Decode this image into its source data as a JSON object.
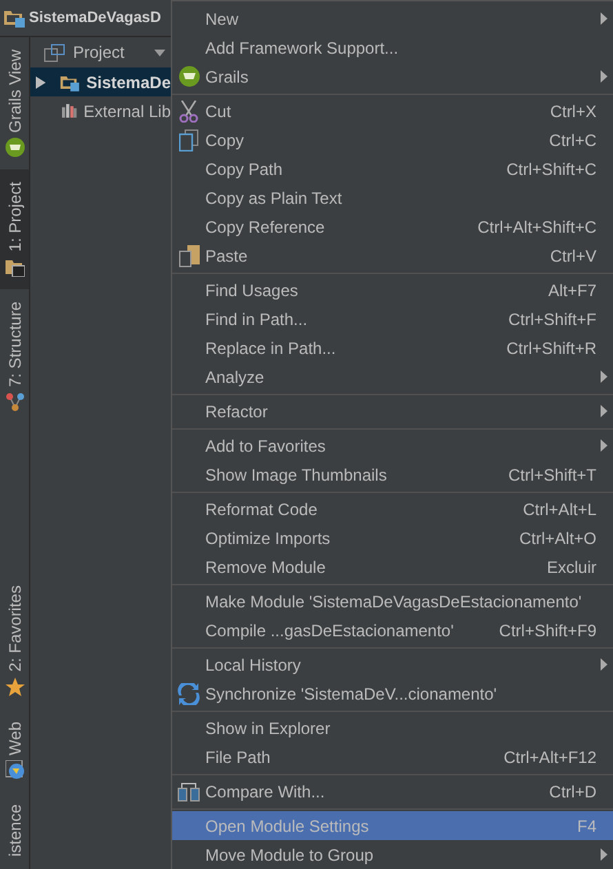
{
  "window": {
    "title": "SistemaDeVagasD"
  },
  "tool_tabs_top": [
    {
      "label": "Grails View",
      "selected": false
    },
    {
      "label": "1: Project",
      "selected": true
    },
    {
      "label": "7: Structure",
      "selected": false
    }
  ],
  "tool_tabs_bottom": [
    {
      "label": "2: Favorites",
      "selected": false
    },
    {
      "label": "Web",
      "selected": false
    },
    {
      "label": "istence",
      "selected": false
    }
  ],
  "project_panel": {
    "title": "Project",
    "tree": [
      {
        "label": "SistemaDe",
        "kind": "module",
        "selected": true
      },
      {
        "label": "External Lib",
        "kind": "library",
        "selected": false
      }
    ]
  },
  "context_menu": {
    "groups": [
      [
        {
          "label": "New",
          "submenu": true,
          "selected": false
        },
        {
          "label": "Add Framework Support...",
          "submenu": false,
          "selected": false
        },
        {
          "label": "Grails",
          "submenu": true,
          "selected": false
        }
      ],
      [
        {
          "label": "Cut",
          "shortcut": "Ctrl+X",
          "submenu": false,
          "selected": false
        },
        {
          "label": "Copy",
          "shortcut": "Ctrl+C",
          "submenu": false,
          "selected": false
        },
        {
          "label": "Copy Path",
          "shortcut": "Ctrl+Shift+C",
          "submenu": false,
          "selected": false
        },
        {
          "label": "Copy as Plain Text",
          "submenu": false,
          "selected": false
        },
        {
          "label": "Copy Reference",
          "shortcut": "Ctrl+Alt+Shift+C",
          "submenu": false,
          "selected": false
        },
        {
          "label": "Paste",
          "shortcut": "Ctrl+V",
          "submenu": false,
          "selected": false
        }
      ],
      [
        {
          "label": "Find Usages",
          "shortcut": "Alt+F7",
          "submenu": false,
          "selected": false
        },
        {
          "label": "Find in Path...",
          "shortcut": "Ctrl+Shift+F",
          "submenu": false,
          "selected": false
        },
        {
          "label": "Replace in Path...",
          "shortcut": "Ctrl+Shift+R",
          "submenu": false,
          "selected": false
        },
        {
          "label": "Analyze",
          "submenu": true,
          "selected": false
        }
      ],
      [
        {
          "label": "Refactor",
          "submenu": true,
          "selected": false
        }
      ],
      [
        {
          "label": "Add to Favorites",
          "submenu": true,
          "selected": false
        },
        {
          "label": "Show Image Thumbnails",
          "shortcut": "Ctrl+Shift+T",
          "submenu": false,
          "selected": false
        }
      ],
      [
        {
          "label": "Reformat Code",
          "shortcut": "Ctrl+Alt+L",
          "submenu": false,
          "selected": false
        },
        {
          "label": "Optimize Imports",
          "shortcut": "Ctrl+Alt+O",
          "submenu": false,
          "selected": false
        },
        {
          "label": "Remove Module",
          "shortcut": "Excluir",
          "submenu": false,
          "selected": false
        }
      ],
      [
        {
          "label": "Make Module 'SistemaDeVagasDeEstacionamento'",
          "submenu": false,
          "selected": false
        },
        {
          "label": "Compile ...gasDeEstacionamento'",
          "shortcut": "Ctrl+Shift+F9",
          "submenu": false,
          "selected": false
        }
      ],
      [
        {
          "label": "Local History",
          "submenu": true,
          "selected": false
        },
        {
          "label": "Synchronize 'SistemaDeV...cionamento'",
          "submenu": false,
          "selected": false
        }
      ],
      [
        {
          "label": "Show in Explorer",
          "submenu": false,
          "selected": false
        },
        {
          "label": "File Path",
          "shortcut": "Ctrl+Alt+F12",
          "submenu": false,
          "selected": false
        }
      ],
      [
        {
          "label": "Compare With...",
          "shortcut": "Ctrl+D",
          "submenu": false,
          "selected": false
        }
      ],
      [
        {
          "label": "Open Module Settings",
          "shortcut": "F4",
          "submenu": false,
          "selected": true
        },
        {
          "label": "Move Module to Group",
          "submenu": true,
          "selected": false
        }
      ]
    ]
  }
}
